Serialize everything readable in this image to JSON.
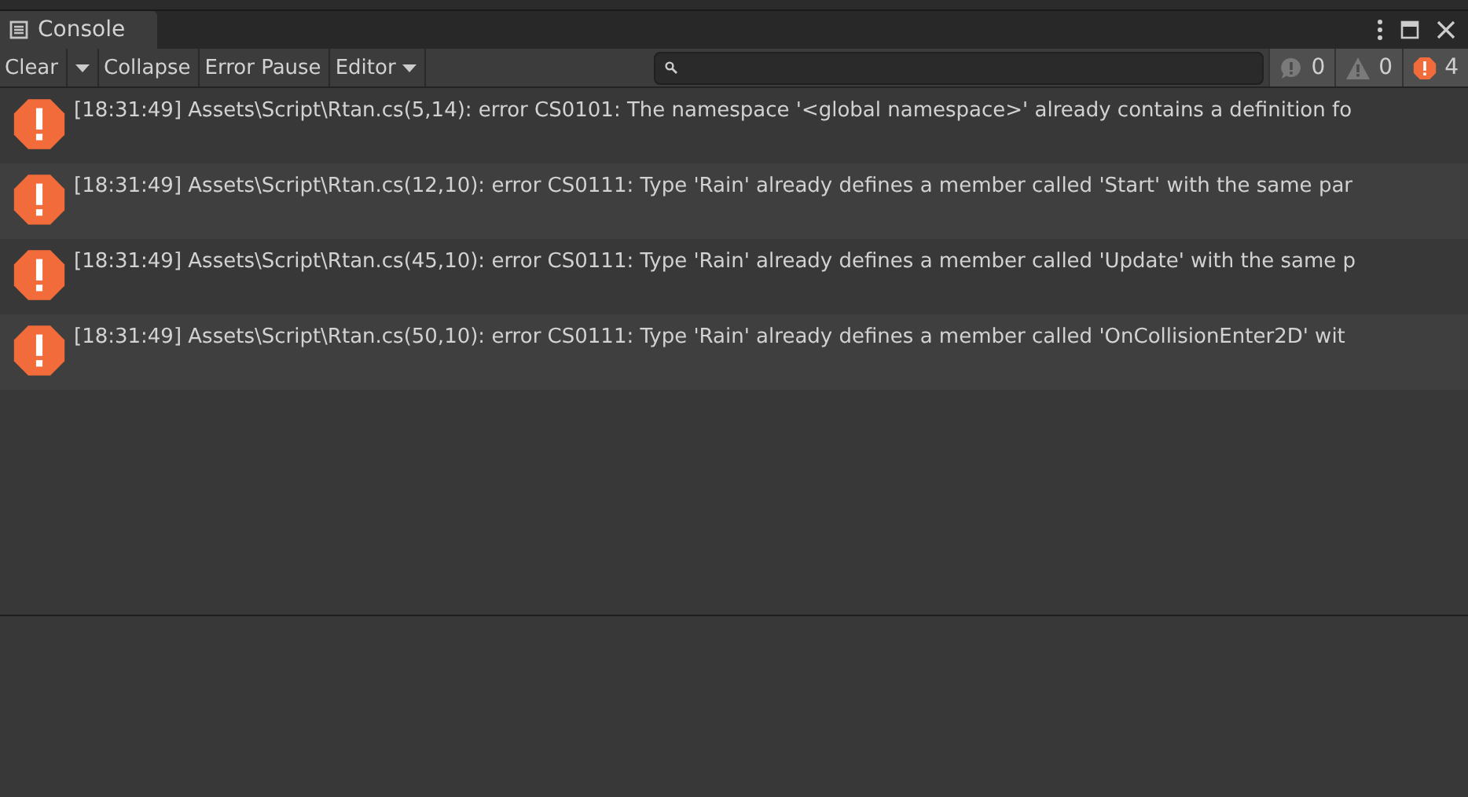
{
  "window": {
    "title": "Console"
  },
  "toolbar": {
    "clear": "Clear",
    "collapse": {
      "label": "Collapse",
      "on": false
    },
    "error_pause": {
      "label": "Error Pause",
      "on": false
    },
    "editor": "Editor",
    "counters": [
      {
        "kind": "info",
        "count": "0"
      },
      {
        "kind": "warning",
        "count": "0"
      },
      {
        "kind": "error",
        "count": "4"
      }
    ]
  },
  "messages": [
    {
      "kind": "error",
      "text": "[18:31:49] Assets\\Script\\Rtan.cs(5,14): error CS0101: The namespace '<global namespace>' already contains a definition fo"
    },
    {
      "kind": "error",
      "text": "[18:31:49] Assets\\Script\\Rtan.cs(12,10): error CS0111: Type 'Rain' already defines a member called 'Start' with the same par"
    },
    {
      "kind": "error",
      "text": "[18:31:49] Assets\\Script\\Rtan.cs(45,10): error CS0111: Type 'Rain' already defines a member called 'Update' with the same p"
    },
    {
      "kind": "error",
      "text": "[18:31:49] Assets\\Script\\Rtan.cs(50,10): error CS0111: Type 'Rain' already defines a member called 'OnCollisionEnter2D' wit"
    }
  ]
}
